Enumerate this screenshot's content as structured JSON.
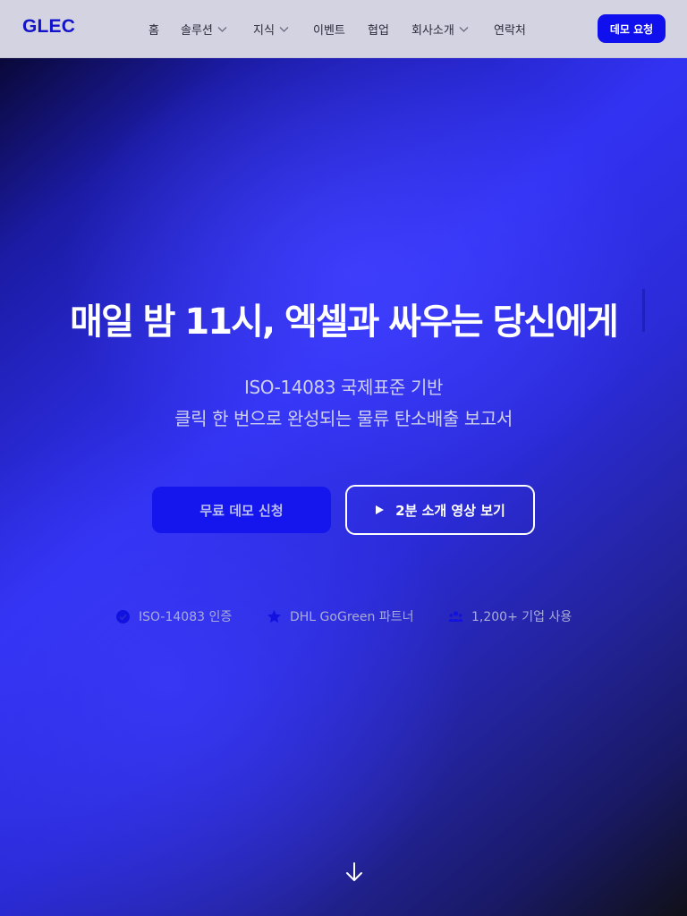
{
  "brand": {
    "logo": "GLEC",
    "accent": "#1010EE"
  },
  "nav": {
    "items": [
      {
        "label": "홈",
        "dropdown": false
      },
      {
        "label": "솔루션",
        "dropdown": true
      },
      {
        "label": "지식",
        "dropdown": true
      },
      {
        "label": "이벤트",
        "dropdown": false
      },
      {
        "label": "협업",
        "dropdown": false
      },
      {
        "label": "회사소개",
        "dropdown": true
      },
      {
        "label": "연락처",
        "dropdown": false
      }
    ],
    "cta_label": "데모 요청"
  },
  "hero": {
    "headline": "매일 밤 11시, 엑셀과 싸우는 당신에게",
    "subline_1": "ISO-14083 국제표준 기반",
    "subline_2": "클릭 한 번으로 완성되는 물류 탄소배출 보고서",
    "primary_button": "무료 데모 신청",
    "secondary_button": "2분 소개 영상 보기",
    "secondary_icon": "play-icon",
    "badges": [
      {
        "icon": "check-circle-icon",
        "label": "ISO-14083 인증"
      },
      {
        "icon": "star-icon",
        "label": "DHL GoGreen 파트너"
      },
      {
        "icon": "users-icon",
        "label": "1,200+ 기업 사용"
      }
    ],
    "scroll_icon": "arrow-down-icon"
  }
}
